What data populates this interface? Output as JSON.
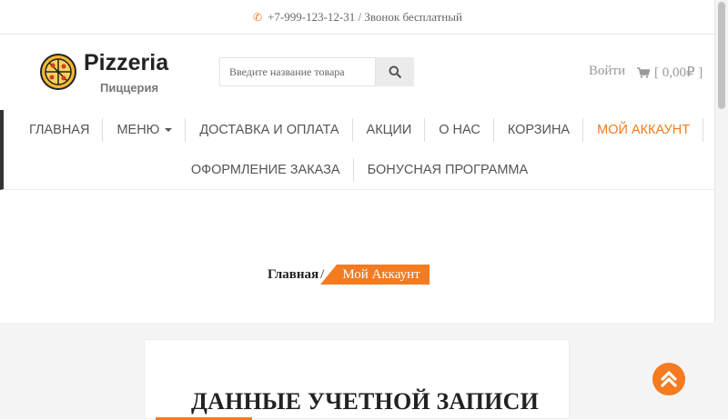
{
  "topbar": {
    "phone_icon": "phone-icon",
    "text": "+7-999-123-12-31 / Звонок бесплатный"
  },
  "logo": {
    "icon": "pizza-icon",
    "title": "Pizzeria",
    "subtitle": "Пиццерия"
  },
  "search": {
    "placeholder": "Введите название товара",
    "button_icon": "search-icon"
  },
  "header": {
    "login": "Войти",
    "cart": "[ 0,00₽ ]",
    "cart_icon": "cart-icon"
  },
  "nav": {
    "row1": [
      {
        "label": "Главная"
      },
      {
        "label": "Меню"
      },
      {
        "label": "Доставка и оплата"
      },
      {
        "label": "Акции"
      },
      {
        "label": "О нас"
      },
      {
        "label": "Корзина"
      },
      {
        "label": "Мой аккаунт"
      }
    ],
    "row2": [
      {
        "label": "Оформление заказа"
      },
      {
        "label": "Бонусная программа"
      }
    ],
    "active_index": 6
  },
  "breadcrumb": {
    "home": "Главная",
    "separator": "/",
    "current": "Мой Аккаунт"
  },
  "account": {
    "title": "ДАННЫЕ УЧЕТНОЙ ЗАПИСИ"
  },
  "colors": {
    "accent": "#f47b20",
    "text": "#555555",
    "background_light": "#f4f4f4"
  }
}
